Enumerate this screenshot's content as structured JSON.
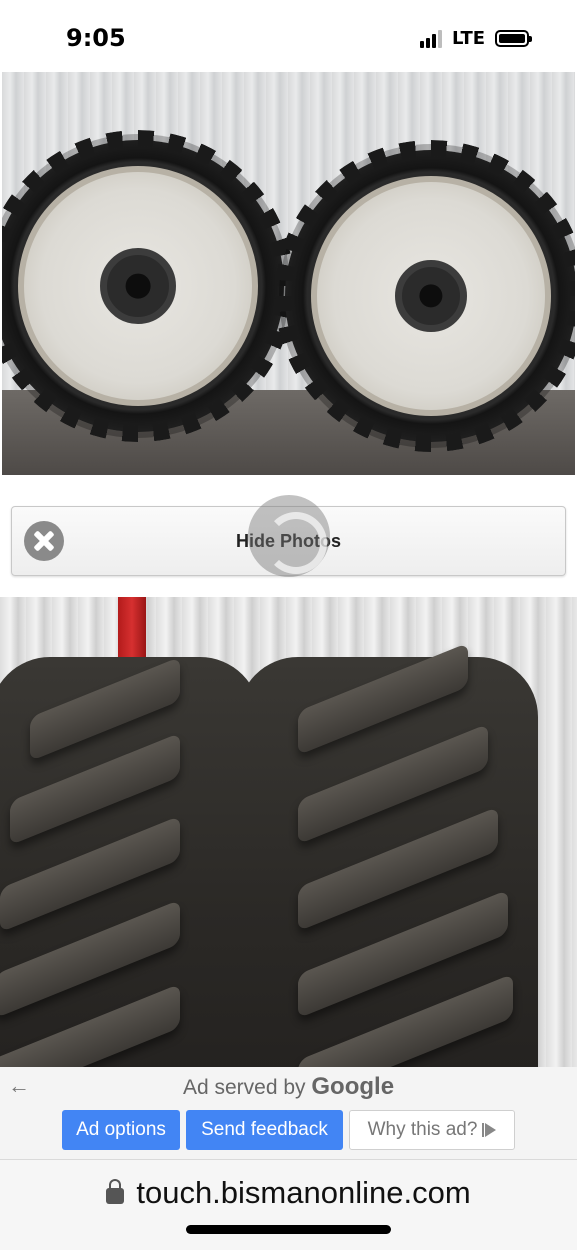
{
  "status_bar": {
    "time": "9:05",
    "network": "LTE",
    "signal_bars_active": 3,
    "signal_bars_total": 4,
    "battery_level": 1.0
  },
  "photos": [
    {
      "icon": "wheels-photo"
    },
    {
      "icon": "tire-tread-photo"
    }
  ],
  "hide_photos": {
    "label": "Hide Photos",
    "icon": "close-icon"
  },
  "ad": {
    "served_by_prefix": "Ad served by",
    "served_by_brand": "Google",
    "buttons": {
      "ad_options": "Ad options",
      "send_feedback": "Send feedback",
      "why_this_ad": "Why this ad?"
    },
    "colors": {
      "button_blue": "#4285f4"
    }
  },
  "browser": {
    "url": "touch.bismanonline.com"
  }
}
